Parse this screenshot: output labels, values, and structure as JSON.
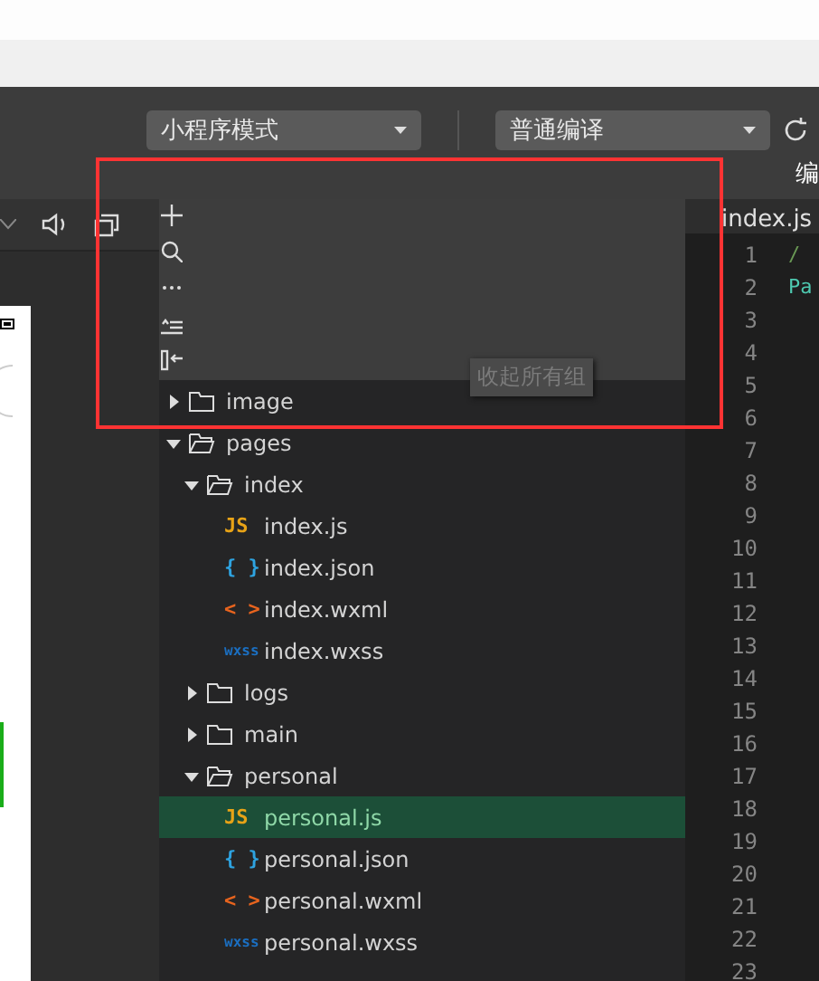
{
  "toolbar": {
    "dropdowns": [
      {
        "label": "小程序模式"
      },
      {
        "label": "普通编译"
      }
    ],
    "compile_label": "编"
  },
  "explorer": {
    "tooltip": "收起所有组",
    "tree": [
      {
        "name": "image",
        "kind": "folder",
        "expanded": false
      },
      {
        "name": "pages",
        "kind": "folder",
        "expanded": true,
        "children": [
          {
            "name": "index",
            "kind": "folder",
            "expanded": true,
            "children": [
              {
                "name": "index.js",
                "kind": "js",
                "badge": "JS",
                "selected": false
              },
              {
                "name": "index.json",
                "kind": "json",
                "badge": "{ }",
                "selected": false
              },
              {
                "name": "index.wxml",
                "kind": "wxml",
                "badge": "< >",
                "selected": false
              },
              {
                "name": "index.wxss",
                "kind": "wxss",
                "badge": "wxss",
                "selected": false
              }
            ]
          },
          {
            "name": "logs",
            "kind": "folder",
            "expanded": false
          },
          {
            "name": "main",
            "kind": "folder",
            "expanded": false
          },
          {
            "name": "personal",
            "kind": "folder",
            "expanded": true,
            "children": [
              {
                "name": "personal.js",
                "kind": "js",
                "badge": "JS",
                "selected": true
              },
              {
                "name": "personal.json",
                "kind": "json",
                "badge": "{ }",
                "selected": false
              },
              {
                "name": "personal.wxml",
                "kind": "wxml",
                "badge": "< >",
                "selected": false
              },
              {
                "name": "personal.wxss",
                "kind": "wxss",
                "badge": "wxss",
                "selected": false
              }
            ]
          }
        ]
      }
    ]
  },
  "editor": {
    "tab": "index.js",
    "line_numbers": [
      "1",
      "2",
      "3",
      "4",
      "5",
      "6",
      "7",
      "8",
      "9",
      "10",
      "11",
      "12",
      "13",
      "14",
      "15",
      "16",
      "17",
      "18",
      "19",
      "20",
      "21",
      "22",
      "23"
    ],
    "code": [
      {
        "kind": "comment",
        "text": "/"
      },
      {
        "kind": "keyword",
        "text": "Pa"
      }
    ]
  }
}
